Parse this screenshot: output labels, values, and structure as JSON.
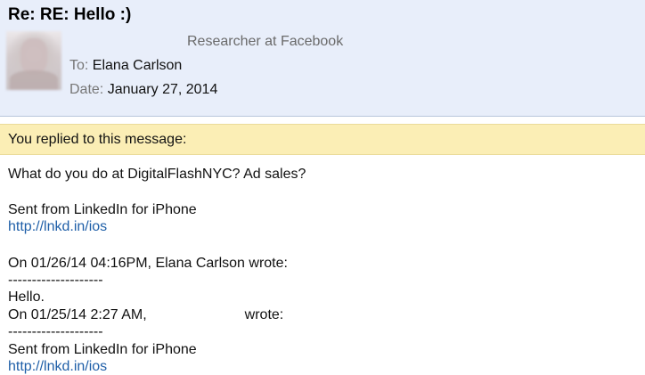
{
  "email": {
    "subject": "Re: RE: Hello :)",
    "sender_title": "Researcher at Facebook",
    "to_label": "To:",
    "to_value": "Elana Carlson",
    "date_label": "Date:",
    "date_value": "January 27, 2014"
  },
  "notice": {
    "replied": "You replied to this message:"
  },
  "body": {
    "line1": "What do you do at DigitalFlashNYC? Ad sales?",
    "sent_from_1": "Sent from LinkedIn for iPhone",
    "link_1": "http://lnkd.in/ios",
    "quote_header": "On 01/26/14 04:16PM, Elana Carlson wrote:",
    "dashes_1": "--------------------",
    "hello": "Hello.",
    "quote2_prefix": "On 01/25/14 2:27 AM,",
    "quote2_suffix": "wrote:",
    "dashes_2": "--------------------",
    "sent_from_2": "Sent from LinkedIn for iPhone",
    "link_2": "http://lnkd.in/ios"
  }
}
